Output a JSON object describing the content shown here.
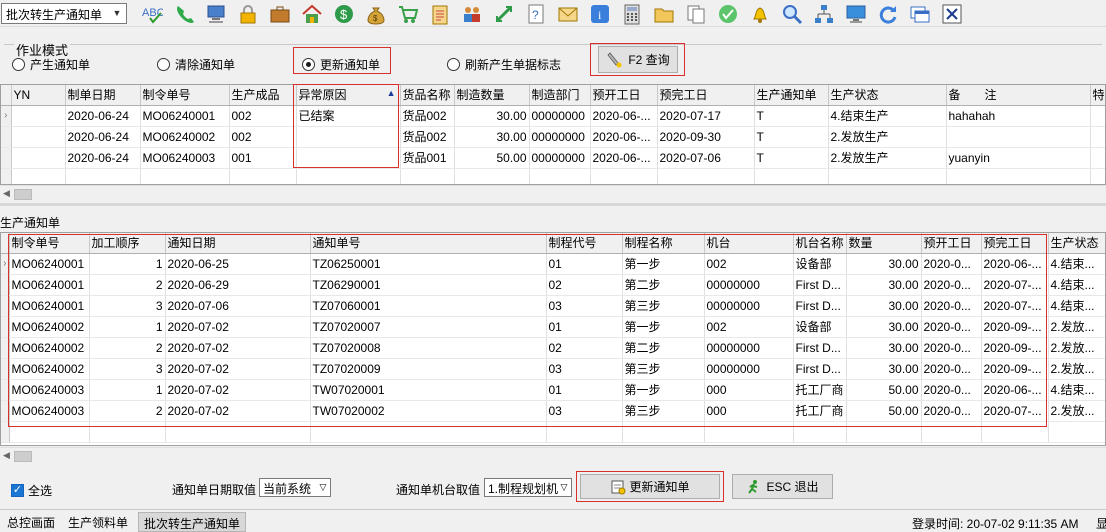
{
  "toolbar": {
    "combo_value": "批次转生产通知单",
    "icons": [
      "spellcheck-icon",
      "phone-icon",
      "computer-icon",
      "lock-icon",
      "briefcase-icon",
      "home-icon",
      "dollar-icon",
      "money-bag-icon",
      "cart-icon",
      "clipboard-icon",
      "users-icon",
      "transfer-icon",
      "help-doc-icon",
      "mail-icon",
      "info-icon",
      "calculator-icon",
      "folder-icon",
      "copy-icon",
      "check-icon",
      "bell-icon",
      "search-icon",
      "org-chart-icon",
      "monitor-icon",
      "refresh-icon",
      "window-icon",
      "close-icon"
    ]
  },
  "mode": {
    "title": "作业模式",
    "options": [
      "产生通知单",
      "清除通知单",
      "更新通知单",
      "刷新产生单据标志"
    ],
    "selected": 2,
    "query_button": "F2 查询"
  },
  "top_grid": {
    "columns": [
      "YN",
      "制单日期",
      "制令单号",
      "生产成品",
      "异常原因",
      "货品名称",
      "制造数量",
      "制造部门",
      "预开工日",
      "预完工日",
      "生产通知单",
      "生产状态",
      "备　　注",
      "特"
    ],
    "sort_column": 4,
    "rows": [
      [
        "",
        "2020-06-24",
        "MO06240001",
        "002",
        "已结案",
        "货品002",
        "30.00",
        "00000000",
        "2020-06-...",
        "2020-07-17",
        "T",
        "4.结束生产",
        "hahahah",
        ""
      ],
      [
        "",
        "2020-06-24",
        "MO06240002",
        "002",
        "",
        "货品002",
        "30.00",
        "00000000",
        "2020-06-...",
        "2020-09-30",
        "T",
        "2.发放生产",
        "",
        ""
      ],
      [
        "",
        "2020-06-24",
        "MO06240003",
        "001",
        "",
        "货品001",
        "50.00",
        "00000000",
        "2020-06-...",
        "2020-07-06",
        "T",
        "2.发放生产",
        "yuanyin",
        ""
      ]
    ]
  },
  "section_label": "生产通知单",
  "bottom_grid": {
    "columns": [
      "制令单号",
      "加工顺序",
      "通知日期",
      "通知单号",
      "制程代号",
      "制程名称",
      "机台",
      "机台名称",
      "数量",
      "预开工日",
      "预完工日",
      "生产状态"
    ],
    "rows": [
      [
        "MO06240001",
        "1",
        "2020-06-25",
        "TZ06250001",
        "01",
        "第一步",
        "002",
        "设备部",
        "30.00",
        "2020-0...",
        "2020-06-...",
        "4.结束..."
      ],
      [
        "MO06240001",
        "2",
        "2020-06-29",
        "TZ06290001",
        "02",
        "第二步",
        "00000000",
        "First D...",
        "30.00",
        "2020-0...",
        "2020-07-...",
        "4.结束..."
      ],
      [
        "MO06240001",
        "3",
        "2020-07-06",
        "TZ07060001",
        "03",
        "第三步",
        "00000000",
        "First D...",
        "30.00",
        "2020-0...",
        "2020-07-...",
        "4.结束..."
      ],
      [
        "MO06240002",
        "1",
        "2020-07-02",
        "TZ07020007",
        "01",
        "第一步",
        "002",
        "设备部",
        "30.00",
        "2020-0...",
        "2020-09-...",
        "2.发放..."
      ],
      [
        "MO06240002",
        "2",
        "2020-07-02",
        "TZ07020008",
        "02",
        "第二步",
        "00000000",
        "First D...",
        "30.00",
        "2020-0...",
        "2020-09-...",
        "2.发放..."
      ],
      [
        "MO06240002",
        "3",
        "2020-07-02",
        "TZ07020009",
        "03",
        "第三步",
        "00000000",
        "First D...",
        "30.00",
        "2020-0...",
        "2020-09-...",
        "2.发放..."
      ],
      [
        "MO06240003",
        "1",
        "2020-07-02",
        "TW07020001",
        "01",
        "第一步",
        "000",
        "托工厂商",
        "50.00",
        "2020-0...",
        "2020-06-...",
        "4.结束..."
      ],
      [
        "MO06240003",
        "2",
        "2020-07-02",
        "TW07020002",
        "03",
        "第三步",
        "000",
        "托工厂商",
        "50.00",
        "2020-0...",
        "2020-07-...",
        "2.发放..."
      ]
    ]
  },
  "bottom": {
    "select_all": "全选",
    "date_label": "通知单日期取值",
    "date_value": "当前系统",
    "machine_label": "通知单机台取值",
    "machine_value": "1.制程规划机",
    "update_button": "更新通知单",
    "exit_button": "ESC 退出"
  },
  "status": {
    "tabs": [
      "总控画面",
      "生产领料单",
      "批次转生产通知单"
    ],
    "active_tab": 2,
    "login_time": "登录时间: 20-07-02 9:11:35 AM",
    "trailing": "显"
  }
}
